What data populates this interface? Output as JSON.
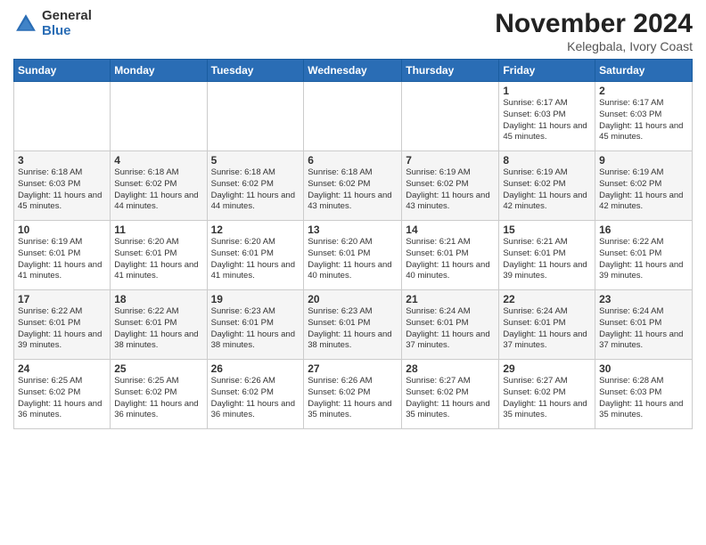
{
  "header": {
    "logo_general": "General",
    "logo_blue": "Blue",
    "month_title": "November 2024",
    "location": "Kelegbala, Ivory Coast"
  },
  "days_of_week": [
    "Sunday",
    "Monday",
    "Tuesday",
    "Wednesday",
    "Thursday",
    "Friday",
    "Saturday"
  ],
  "weeks": [
    [
      {
        "day": "",
        "info": ""
      },
      {
        "day": "",
        "info": ""
      },
      {
        "day": "",
        "info": ""
      },
      {
        "day": "",
        "info": ""
      },
      {
        "day": "",
        "info": ""
      },
      {
        "day": "1",
        "info": "Sunrise: 6:17 AM\nSunset: 6:03 PM\nDaylight: 11 hours and 45 minutes."
      },
      {
        "day": "2",
        "info": "Sunrise: 6:17 AM\nSunset: 6:03 PM\nDaylight: 11 hours and 45 minutes."
      }
    ],
    [
      {
        "day": "3",
        "info": "Sunrise: 6:18 AM\nSunset: 6:03 PM\nDaylight: 11 hours and 45 minutes."
      },
      {
        "day": "4",
        "info": "Sunrise: 6:18 AM\nSunset: 6:02 PM\nDaylight: 11 hours and 44 minutes."
      },
      {
        "day": "5",
        "info": "Sunrise: 6:18 AM\nSunset: 6:02 PM\nDaylight: 11 hours and 44 minutes."
      },
      {
        "day": "6",
        "info": "Sunrise: 6:18 AM\nSunset: 6:02 PM\nDaylight: 11 hours and 43 minutes."
      },
      {
        "day": "7",
        "info": "Sunrise: 6:19 AM\nSunset: 6:02 PM\nDaylight: 11 hours and 43 minutes."
      },
      {
        "day": "8",
        "info": "Sunrise: 6:19 AM\nSunset: 6:02 PM\nDaylight: 11 hours and 42 minutes."
      },
      {
        "day": "9",
        "info": "Sunrise: 6:19 AM\nSunset: 6:02 PM\nDaylight: 11 hours and 42 minutes."
      }
    ],
    [
      {
        "day": "10",
        "info": "Sunrise: 6:19 AM\nSunset: 6:01 PM\nDaylight: 11 hours and 41 minutes."
      },
      {
        "day": "11",
        "info": "Sunrise: 6:20 AM\nSunset: 6:01 PM\nDaylight: 11 hours and 41 minutes."
      },
      {
        "day": "12",
        "info": "Sunrise: 6:20 AM\nSunset: 6:01 PM\nDaylight: 11 hours and 41 minutes."
      },
      {
        "day": "13",
        "info": "Sunrise: 6:20 AM\nSunset: 6:01 PM\nDaylight: 11 hours and 40 minutes."
      },
      {
        "day": "14",
        "info": "Sunrise: 6:21 AM\nSunset: 6:01 PM\nDaylight: 11 hours and 40 minutes."
      },
      {
        "day": "15",
        "info": "Sunrise: 6:21 AM\nSunset: 6:01 PM\nDaylight: 11 hours and 39 minutes."
      },
      {
        "day": "16",
        "info": "Sunrise: 6:22 AM\nSunset: 6:01 PM\nDaylight: 11 hours and 39 minutes."
      }
    ],
    [
      {
        "day": "17",
        "info": "Sunrise: 6:22 AM\nSunset: 6:01 PM\nDaylight: 11 hours and 39 minutes."
      },
      {
        "day": "18",
        "info": "Sunrise: 6:22 AM\nSunset: 6:01 PM\nDaylight: 11 hours and 38 minutes."
      },
      {
        "day": "19",
        "info": "Sunrise: 6:23 AM\nSunset: 6:01 PM\nDaylight: 11 hours and 38 minutes."
      },
      {
        "day": "20",
        "info": "Sunrise: 6:23 AM\nSunset: 6:01 PM\nDaylight: 11 hours and 38 minutes."
      },
      {
        "day": "21",
        "info": "Sunrise: 6:24 AM\nSunset: 6:01 PM\nDaylight: 11 hours and 37 minutes."
      },
      {
        "day": "22",
        "info": "Sunrise: 6:24 AM\nSunset: 6:01 PM\nDaylight: 11 hours and 37 minutes."
      },
      {
        "day": "23",
        "info": "Sunrise: 6:24 AM\nSunset: 6:01 PM\nDaylight: 11 hours and 37 minutes."
      }
    ],
    [
      {
        "day": "24",
        "info": "Sunrise: 6:25 AM\nSunset: 6:02 PM\nDaylight: 11 hours and 36 minutes."
      },
      {
        "day": "25",
        "info": "Sunrise: 6:25 AM\nSunset: 6:02 PM\nDaylight: 11 hours and 36 minutes."
      },
      {
        "day": "26",
        "info": "Sunrise: 6:26 AM\nSunset: 6:02 PM\nDaylight: 11 hours and 36 minutes."
      },
      {
        "day": "27",
        "info": "Sunrise: 6:26 AM\nSunset: 6:02 PM\nDaylight: 11 hours and 35 minutes."
      },
      {
        "day": "28",
        "info": "Sunrise: 6:27 AM\nSunset: 6:02 PM\nDaylight: 11 hours and 35 minutes."
      },
      {
        "day": "29",
        "info": "Sunrise: 6:27 AM\nSunset: 6:02 PM\nDaylight: 11 hours and 35 minutes."
      },
      {
        "day": "30",
        "info": "Sunrise: 6:28 AM\nSunset: 6:03 PM\nDaylight: 11 hours and 35 minutes."
      }
    ]
  ]
}
